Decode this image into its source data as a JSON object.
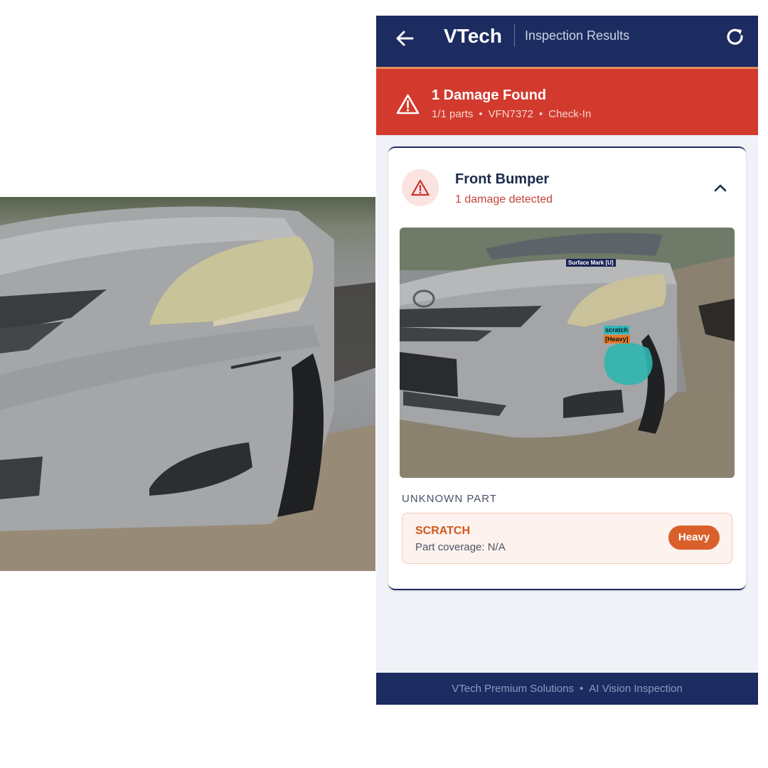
{
  "header": {
    "brand": "VTech",
    "subtitle": "Inspection Results",
    "colors": {
      "bar": "#1c2b60",
      "accent": "#e38f5c"
    }
  },
  "alert": {
    "title": "1 Damage Found",
    "parts": "1/1 parts",
    "plate": "VFN7372",
    "mode": "Check-In",
    "separator": "•",
    "color": "#d23a2e"
  },
  "part_card": {
    "name": "Front Bumper",
    "damage_count": "1 damage detected",
    "photo_tags": {
      "surface": "Surface Mark [U]",
      "label": "scratch",
      "severity": "[Heavy]"
    },
    "section_label": "UNKNOWN PART",
    "damages": [
      {
        "type": "SCRATCH",
        "coverage": "Part coverage: N/A",
        "severity": "Heavy"
      }
    ]
  },
  "footer": {
    "left": "VTech Premium Solutions",
    "separator": "•",
    "right": "AI Vision Inspection"
  },
  "icons": {
    "back": "arrow-left-icon",
    "refresh": "refresh-icon",
    "alert": "warning-triangle-icon",
    "collapse": "chevron-up-icon"
  }
}
